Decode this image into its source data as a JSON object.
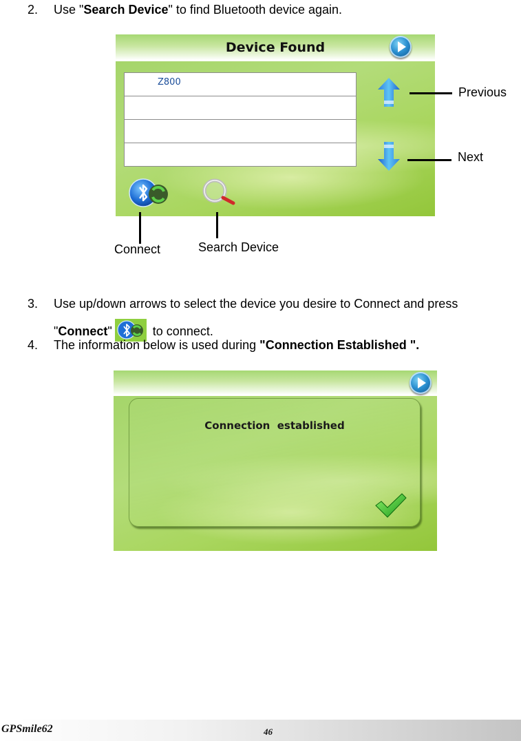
{
  "steps": [
    {
      "number": "2.",
      "parts": [
        {
          "text": "Use \"",
          "bold": false
        },
        {
          "text": "Search Device",
          "bold": true
        },
        {
          "text": "\" to find Bluetooth device again.",
          "bold": false
        }
      ]
    },
    {
      "number": "3.",
      "line1": "Use up/down arrows to select the device you desire to Connect and press",
      "line2_prefix": "\"",
      "line2_bold": "Connect",
      "line2_suffix_quote": "\"",
      "line2_after_icon": "to connect.",
      "icon": "bluetooth-connect-icon"
    },
    {
      "number": "4.",
      "text": "The information below is used during ",
      "bold": "\"Connection Established \"."
    }
  ],
  "device_found_screen": {
    "title": "Device Found",
    "header_button_icon": "play-icon",
    "devices": [
      "Z800",
      "",
      "",
      ""
    ],
    "buttons": {
      "previous_icon": "arrow-up-icon",
      "next_icon": "arrow-down-icon",
      "connect_icon": "bluetooth-connect-icon",
      "search_icon": "magnifier-icon"
    },
    "callouts": {
      "previous": "Previous",
      "next": "Next",
      "connect": "Connect",
      "search_device": "Search Device"
    }
  },
  "connection_screen": {
    "header_button_icon": "play-icon",
    "message": "Connection  established",
    "confirm_icon": "checkmark-icon"
  },
  "footer": {
    "brand": "GPSmile62",
    "page_number": "46"
  }
}
